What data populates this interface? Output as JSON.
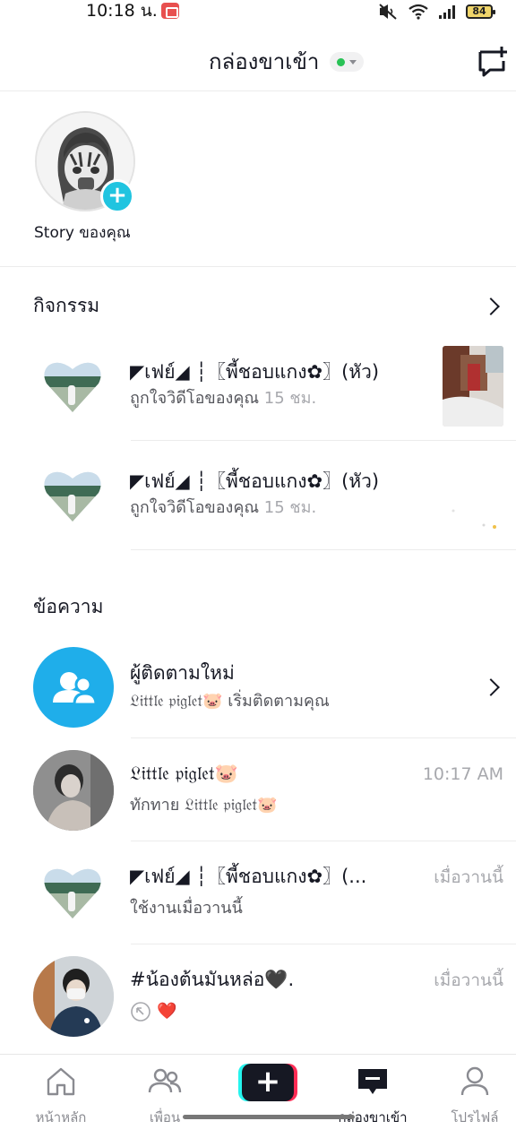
{
  "status_bar": {
    "time": "10:18 น.",
    "battery": "84"
  },
  "header": {
    "title": "กล่องขาเข้า",
    "online_dot_color": "#29c256",
    "compose_icon": "new-message-icon"
  },
  "story": {
    "label": "Story ของคุณ",
    "plus": "+"
  },
  "activity": {
    "title": "กิจกรรม",
    "items": [
      {
        "name": "◤เฟย์◢ ┆〖พี้ชอบแกง✿〗(หัว)",
        "action": "ถูกใจวิดีโอของคุณ",
        "time": "15 ชม."
      },
      {
        "name": "◤เฟย์◢ ┆〖พี้ชอบแกง✿〗(หัว)",
        "action": "ถูกใจวิดีโอของคุณ",
        "time": "15 ชม."
      }
    ]
  },
  "messages": {
    "title": "ข้อความ",
    "new_followers": {
      "title": "ผู้ติดตามใหม่",
      "subtitle": "𝔏𝔦𝔱𝔱𝔩𝔢 𝔭𝔦𝔤𝔩𝔢𝔱🐷 เริ่มติดตามคุณ"
    },
    "items": [
      {
        "name": "𝔏𝔦𝔱𝔱𝔩𝔢 𝔭𝔦𝔤𝔩𝔢𝔱🐷",
        "preview": "ทักทาย 𝔏𝔦𝔱𝔱𝔩𝔢 𝔭𝔦𝔤𝔩𝔢𝔱🐷",
        "time": "10:17 AM"
      },
      {
        "name": "◤เฟย์◢ ┆〖พี้ชอบแกง✿〗(...",
        "preview": "ใช้งานเมื่อวานนี้",
        "time": "เมื่อวานนี้"
      },
      {
        "name": "#น้องต้นมันหล่อ🖤.",
        "preview": "❤️",
        "time": "เมื่อวานนี้"
      }
    ]
  },
  "bottom_nav": {
    "items": [
      {
        "label": "หน้าหลัก",
        "icon": "home-icon"
      },
      {
        "label": "เพื่อน",
        "icon": "friends-icon"
      },
      {
        "label": "+",
        "icon": "create-icon"
      },
      {
        "label": "กล่องขาเข้า",
        "icon": "inbox-icon",
        "active": true
      },
      {
        "label": "โปรไฟล์",
        "icon": "profile-icon"
      }
    ]
  }
}
